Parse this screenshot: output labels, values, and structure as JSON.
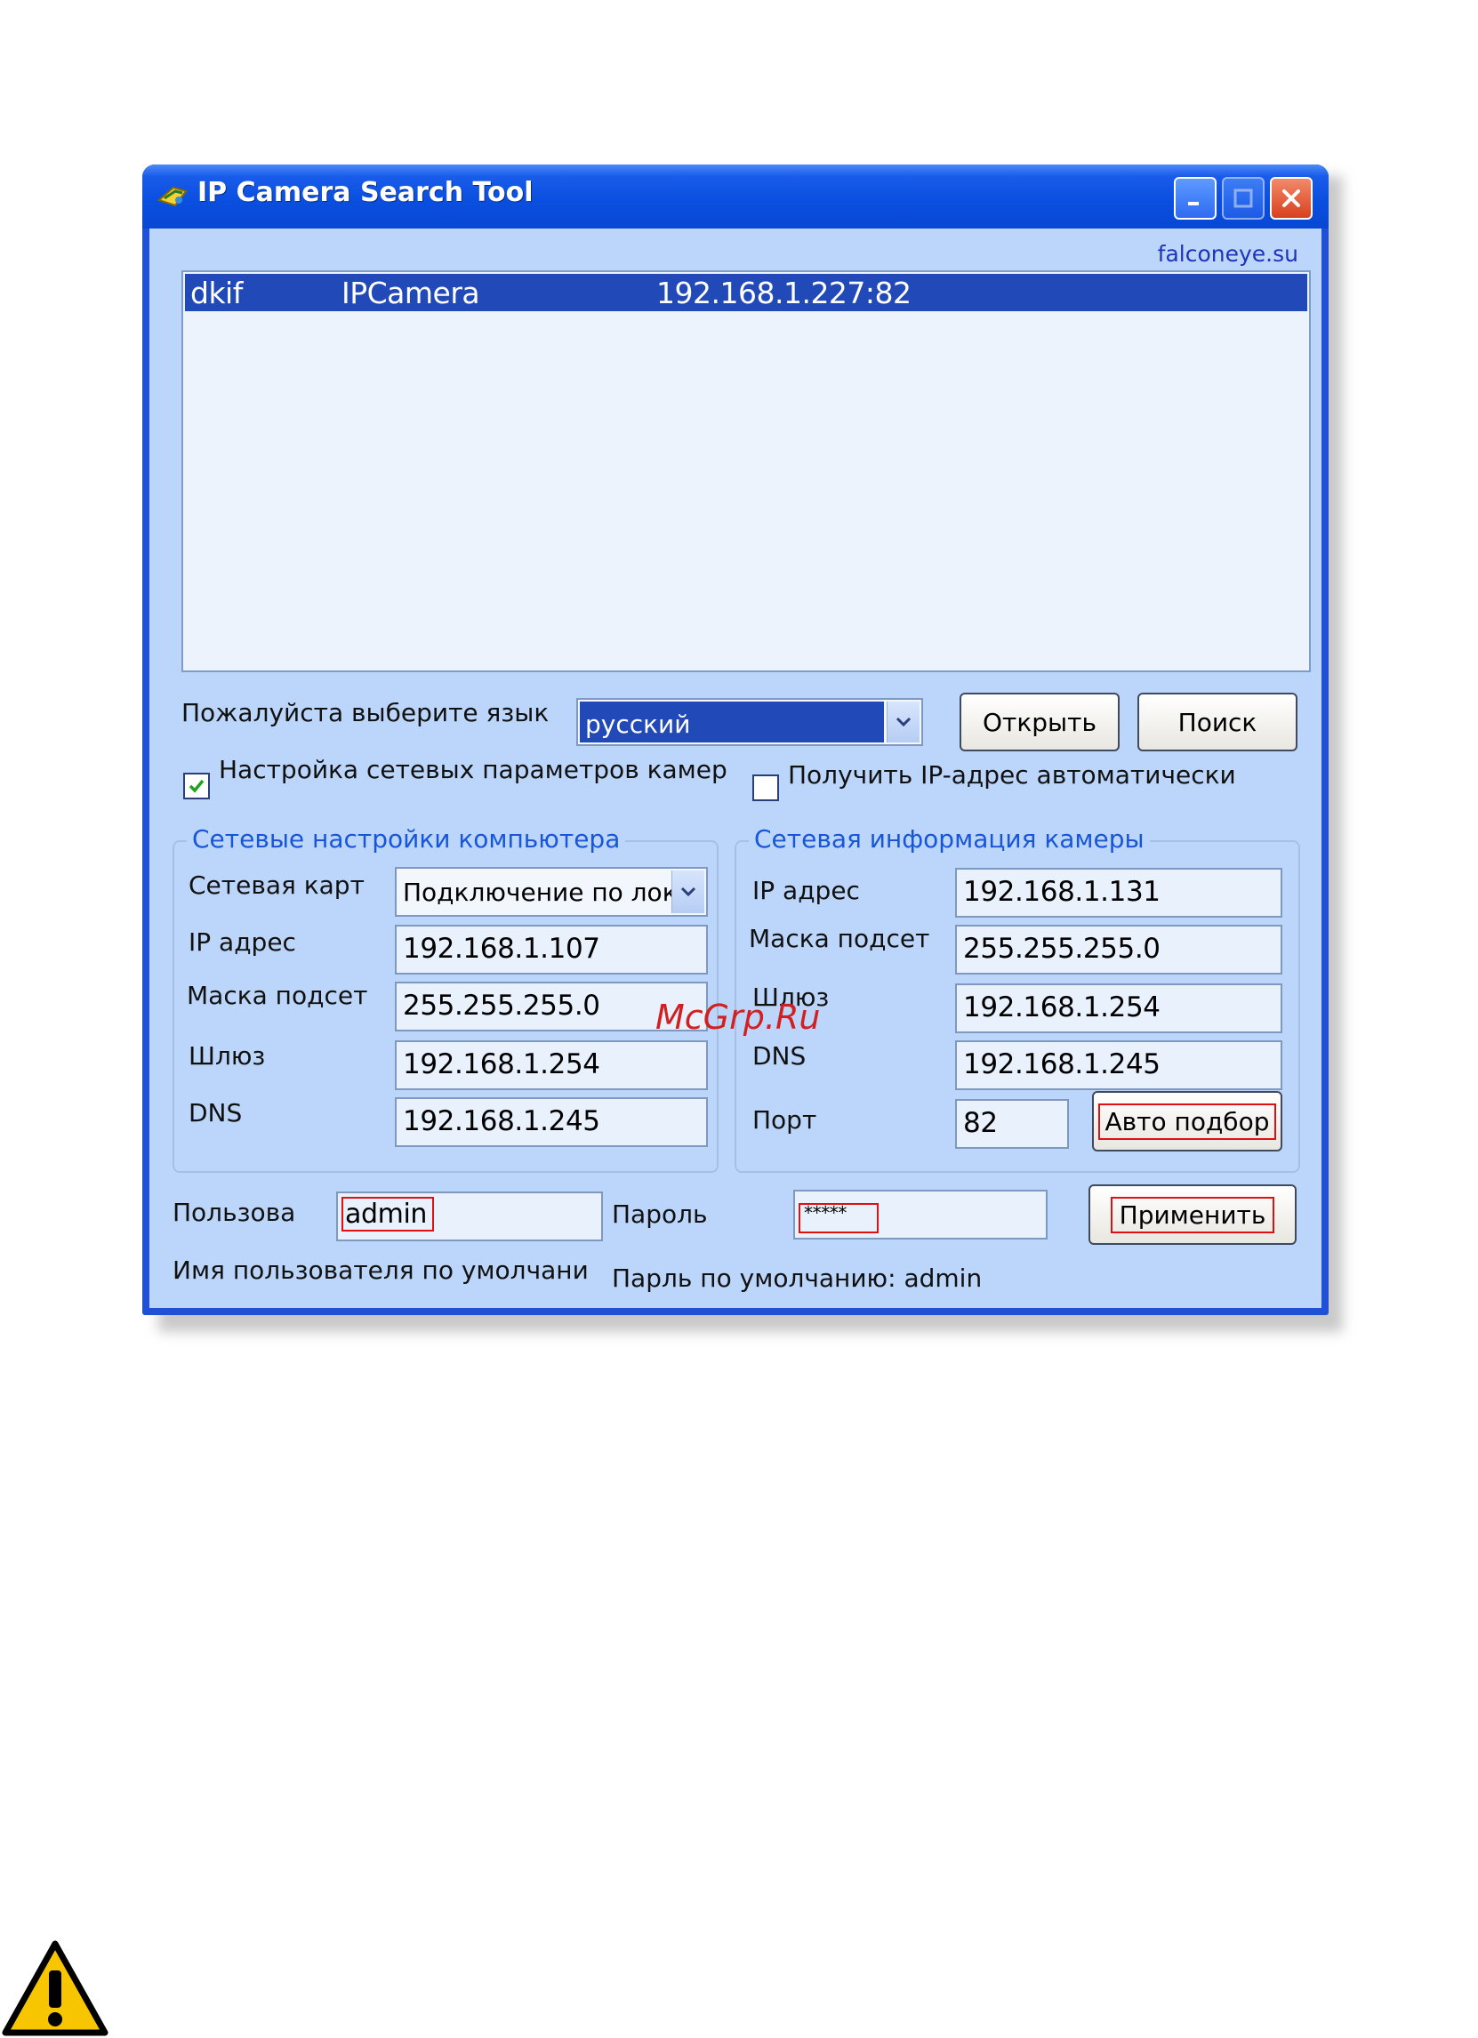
{
  "window": {
    "title": "IP Camera Search Tool",
    "link": "falconeye.su"
  },
  "device_list": {
    "rows": [
      {
        "name": "dkif",
        "type": "IPCamera",
        "address": "192.168.1.227:82"
      }
    ]
  },
  "language": {
    "label": "Пожалуйста выберите язык",
    "selected": "русский"
  },
  "buttons": {
    "open": "Открыть",
    "search": "Поиск",
    "auto": "Авто подбор",
    "apply": "Применить"
  },
  "checkboxes": {
    "network_setup": {
      "label": "Настройка сетевых параметров камер",
      "checked": true
    },
    "auto_ip": {
      "label": "Получить IP-адрес автоматически",
      "checked": false
    }
  },
  "pc_settings": {
    "title": "Сетевые настройки компьютера",
    "adapter_label": "Сетевая карт",
    "adapter_value": "Подключение по лок",
    "ip_label": "IP адрес",
    "ip_value": "192.168.1.107",
    "mask_label": "Маска подсет",
    "mask_value": "255.255.255.0",
    "gateway_label": "Шлюз",
    "gateway_value": "192.168.1.254",
    "dns_label": "DNS",
    "dns_value": "192.168.1.245"
  },
  "camera_info": {
    "title": "Сетевая информация камеры",
    "ip_label": "IP адрес",
    "ip_value": "192.168.1.131",
    "mask_label": "Маска подсет",
    "mask_value": "255.255.255.0",
    "gateway_label": "Шлюз",
    "gateway_value": "192.168.1.254",
    "dns_label": "DNS",
    "dns_value": "192.168.1.245",
    "port_label": "Порт",
    "port_value": "82"
  },
  "credentials": {
    "user_label": "Пользова",
    "user_value": "admin",
    "password_label": "Пароль",
    "password_value": "*****",
    "user_hint": "Имя пользователя по умолчани",
    "password_hint": "Парль по умолчанию: admin"
  },
  "watermark": "McGrp.Ru",
  "colors": {
    "title_bar": "#0a4fe0",
    "client_bg": "#bcd6fb",
    "selection": "#2249b8",
    "group_title": "#1856d9",
    "highlight": "#e01010"
  },
  "icons": [
    "app-icon",
    "minimize-icon",
    "maximize-icon",
    "close-icon",
    "chevron-down-icon",
    "checkmark-icon",
    "warning-icon"
  ]
}
